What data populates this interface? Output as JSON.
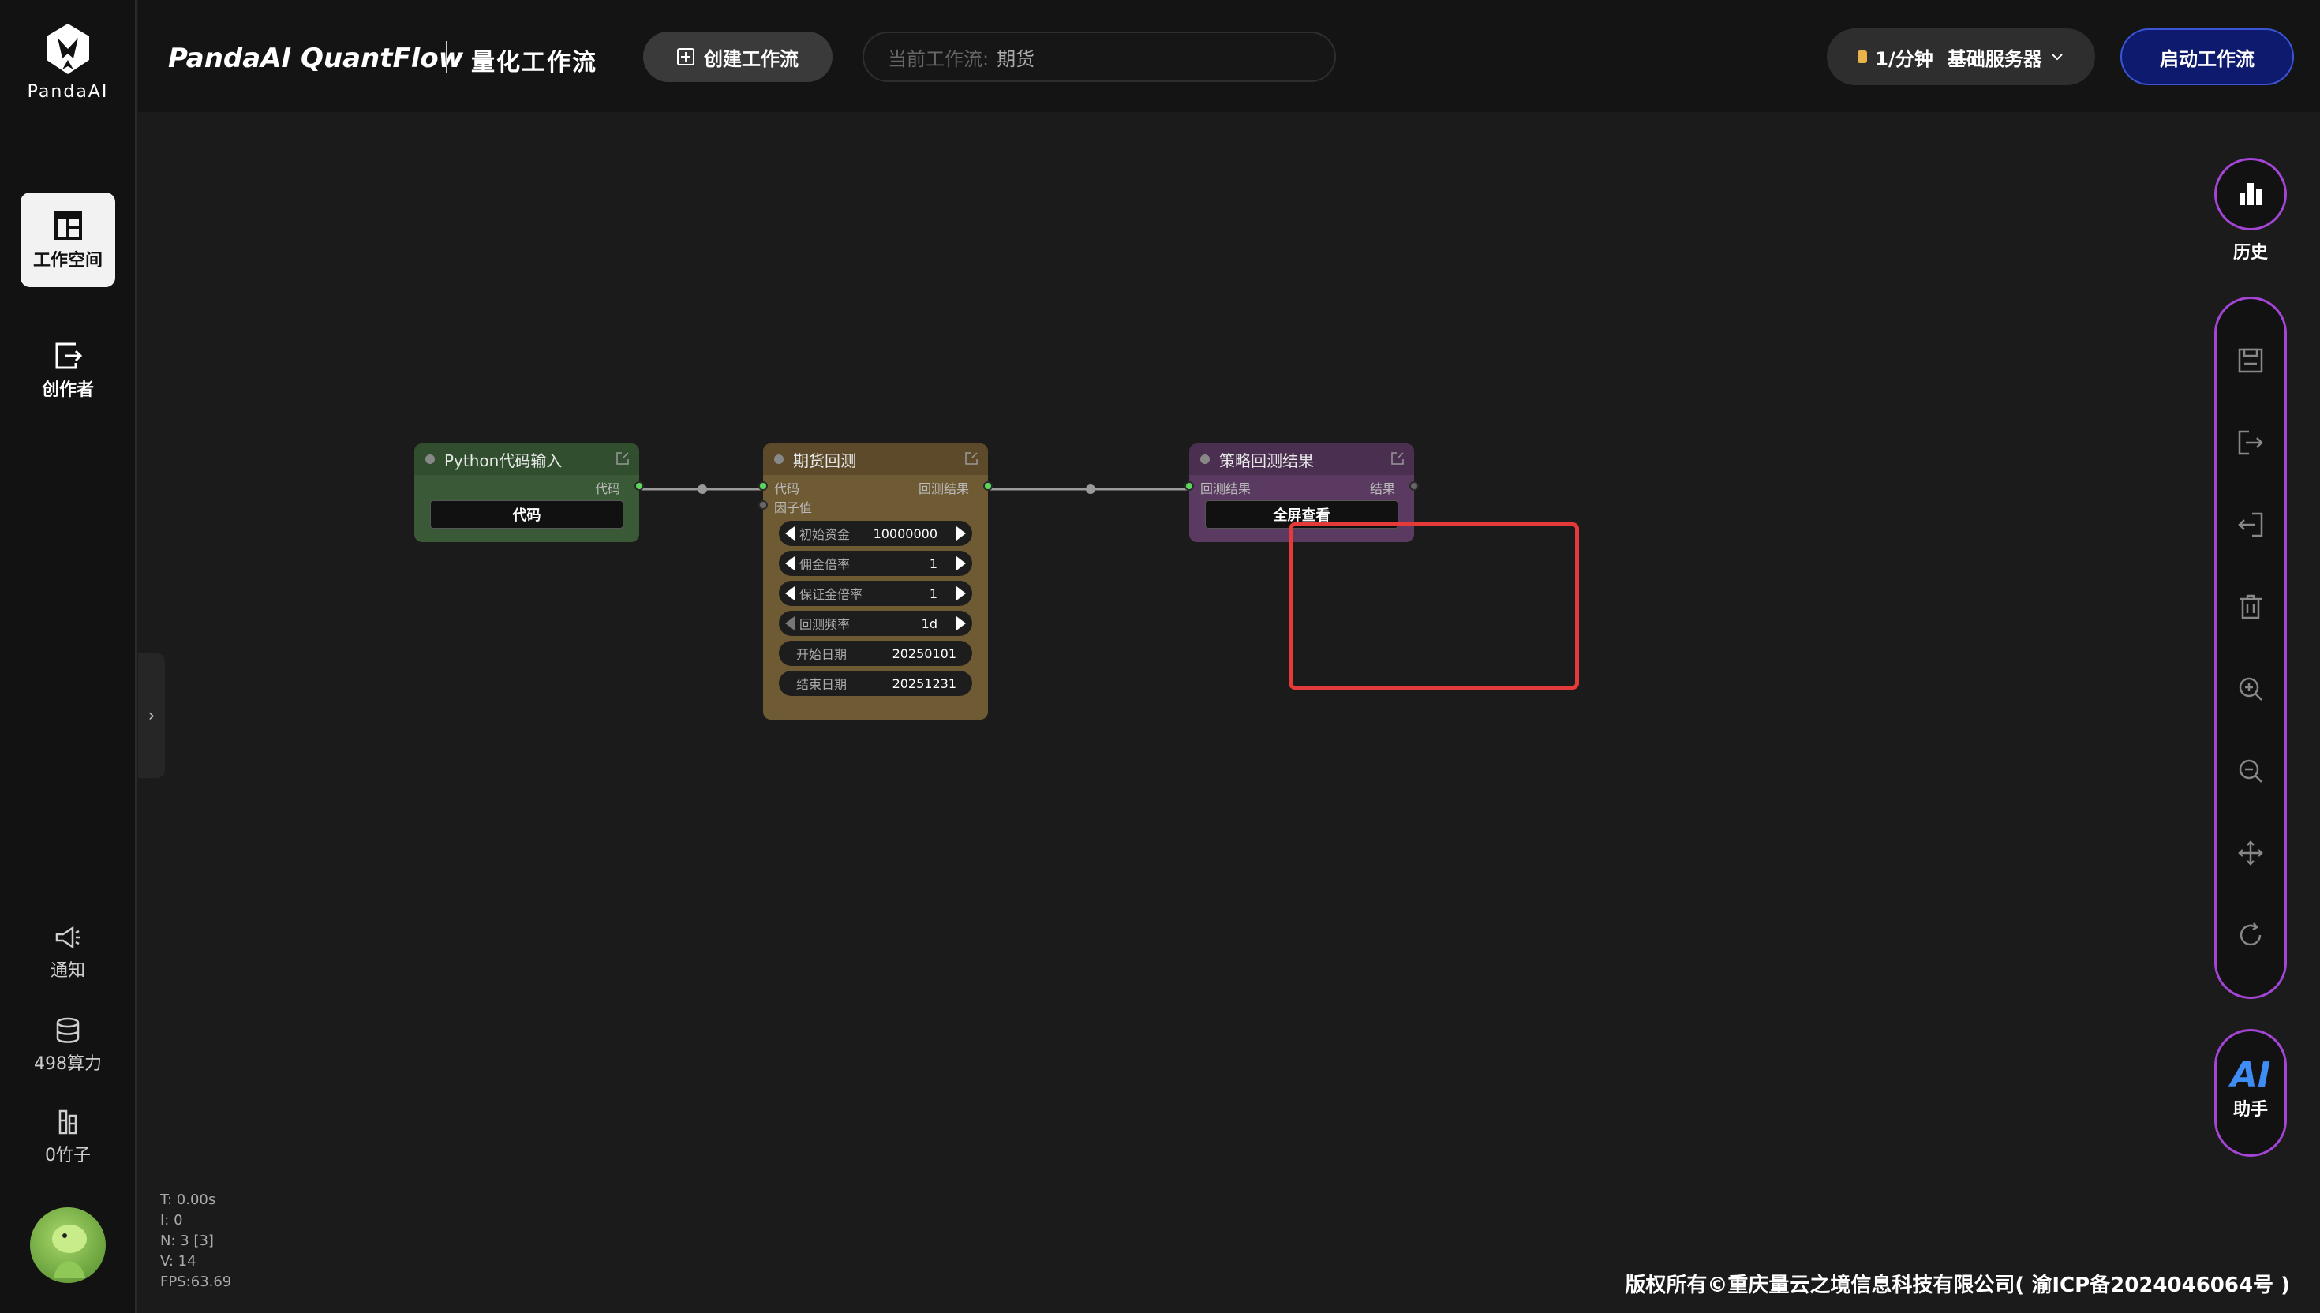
{
  "app": {
    "logo_text": "PandaAI",
    "brand": "PandaAI QuantFlow",
    "subtitle": "量化工作流"
  },
  "sidebar": {
    "items": [
      {
        "label": "工作空间",
        "icon": "workspace-icon",
        "active": true
      },
      {
        "label": "创作者",
        "icon": "creator-icon",
        "active": false
      }
    ],
    "bottom": [
      {
        "label": "通知",
        "icon": "megaphone-icon"
      },
      {
        "label": "498算力",
        "icon": "database-icon"
      },
      {
        "label": "0竹子",
        "icon": "bamboo-icon"
      }
    ]
  },
  "header": {
    "create_label": "创建工作流",
    "current_label": "当前工作流:",
    "current_value": "期货",
    "server_price": "1/分钟",
    "server_name": "基础服务器",
    "start_label": "启动工作流"
  },
  "nodes": {
    "python": {
      "title": "Python代码输入",
      "output": "代码",
      "button": "代码"
    },
    "futures": {
      "title": "期货回测",
      "input1": "代码",
      "input2": "因子值",
      "output": "回测结果",
      "widgets": [
        {
          "label": "初始资金",
          "value": "10000000"
        },
        {
          "label": "佣金倍率",
          "value": "1"
        },
        {
          "label": "保证金倍率",
          "value": "1"
        },
        {
          "label": "回测频率",
          "value": "1d"
        }
      ],
      "dates": [
        {
          "label": "开始日期",
          "value": "20250101"
        },
        {
          "label": "结束日期",
          "value": "20251231"
        }
      ]
    },
    "result": {
      "title": "策略回测结果",
      "input": "回测结果",
      "output": "结果",
      "button": "全屏查看"
    }
  },
  "right_toolbar": {
    "history_label": "历史",
    "tools": [
      "save-icon",
      "export-icon",
      "import-icon",
      "trash-icon",
      "zoom-in-icon",
      "zoom-out-icon",
      "move-icon",
      "refresh-icon"
    ],
    "ai_text": "AI",
    "ai_label": "助手"
  },
  "stats": [
    "T: 0.00s",
    "I: 0",
    "N: 3 [3]",
    "V: 14",
    "FPS:63.69"
  ],
  "footer": "版权所有©重庆量云之境信息科技有限公司( 渝ICP备2024046064号 )",
  "colors": {
    "accent_purple": "#a445d6",
    "start_button": "#0e1a6e",
    "python_node": "#3a5a37",
    "futures_node": "#6e5a33",
    "result_node": "#5a3a60",
    "highlight": "#e63a3a"
  }
}
